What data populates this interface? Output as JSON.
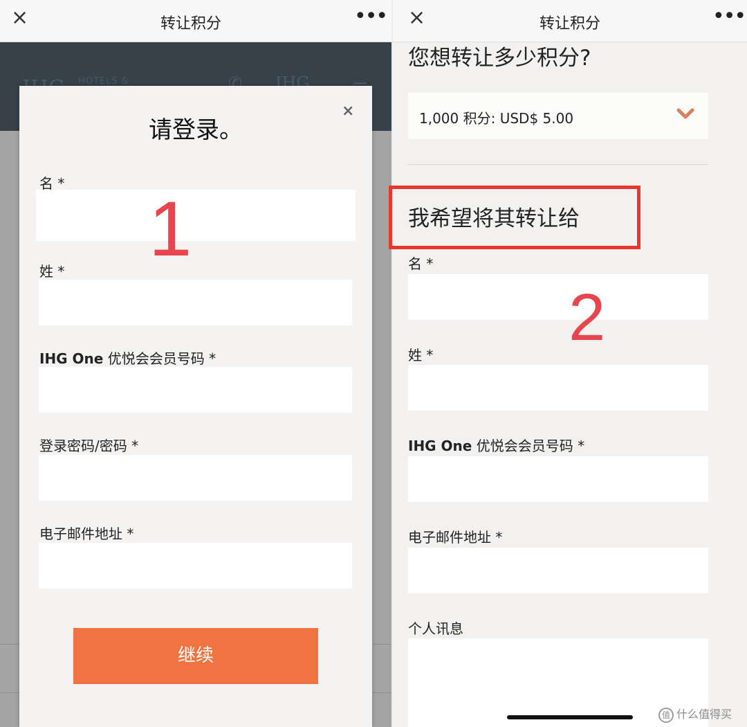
{
  "left": {
    "topbar": {
      "close_icon": "×",
      "title": "转让积分",
      "more_icon": "•••"
    },
    "background": {
      "logo_text": "IHG",
      "logo_subtext": "HOTELS &",
      "phone_icon": "phone-icon",
      "brand_mark": "IHG",
      "menu_icon": "≡",
      "header_color": "#36414a"
    },
    "modal": {
      "title": "请登录。",
      "close_icon": "×",
      "fields": [
        {
          "label": "名",
          "required": "*",
          "value": ""
        },
        {
          "label": "姓",
          "required": "*",
          "value": ""
        },
        {
          "label_bold": "IHG One",
          "label": " 优悦会会员号码",
          "required": "*",
          "value": ""
        },
        {
          "label": "登录密码/密码",
          "required": "*",
          "value": ""
        },
        {
          "label": "电子邮件地址",
          "required": "*",
          "value": ""
        }
      ],
      "continue_label": "继续",
      "accent_color": "#ef7442"
    },
    "annotation_number": "1"
  },
  "right": {
    "topbar": {
      "close_icon": "×",
      "title": "转让积分",
      "more_icon": "•••"
    },
    "points_question": "您想转让多少积分?",
    "points_select": {
      "value": "1,000 积分: USD$ 5.00",
      "chevron_icon": "chevron-down-icon"
    },
    "transfer_to_heading": "我希望将其转让给",
    "fields": [
      {
        "label": "名",
        "required": "*",
        "value": ""
      },
      {
        "label": "姓",
        "required": "*",
        "value": ""
      },
      {
        "label_bold": "IHG One",
        "label": " 优悦会会员号码",
        "required": "*",
        "value": ""
      },
      {
        "label": "电子邮件地址",
        "required": "*",
        "value": ""
      },
      {
        "label": "个人讯息",
        "value": ""
      }
    ],
    "annotation_number": "2",
    "highlight_color": "#e8372c"
  },
  "watermark": {
    "icon_text": "值",
    "text": "什么值得买"
  }
}
